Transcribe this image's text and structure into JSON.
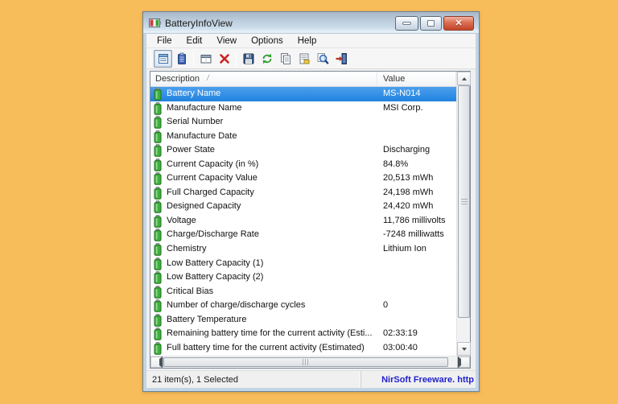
{
  "window": {
    "title": "BatteryInfoView",
    "controls": [
      "minimize-button",
      "maximize-button",
      "close-button"
    ]
  },
  "menu": {
    "items": [
      "File",
      "Edit",
      "View",
      "Options",
      "Help"
    ]
  },
  "toolbar": {
    "icons": [
      "details-view-icon",
      "report-view-icon",
      "choose-columns-icon",
      "delete-icon",
      "save-icon",
      "refresh-icon",
      "copy-icon",
      "properties-icon",
      "find-icon",
      "exit-icon"
    ],
    "active_icon": "details-view-icon"
  },
  "list": {
    "columns": {
      "description": "Description",
      "value": "Value"
    },
    "sort_indicator": "/",
    "rows": [
      {
        "description": "Battery Name",
        "value": "MS-N014",
        "selected": true
      },
      {
        "description": "Manufacture Name",
        "value": "MSI Corp.",
        "selected": false
      },
      {
        "description": "Serial Number",
        "value": "",
        "selected": false
      },
      {
        "description": "Manufacture Date",
        "value": "",
        "selected": false
      },
      {
        "description": "Power State",
        "value": "Discharging",
        "selected": false
      },
      {
        "description": "Current Capacity (in %)",
        "value": "84.8%",
        "selected": false
      },
      {
        "description": "Current Capacity Value",
        "value": "20,513 mWh",
        "selected": false
      },
      {
        "description": "Full Charged Capacity",
        "value": "24,198 mWh",
        "selected": false
      },
      {
        "description": "Designed Capacity",
        "value": "24,420 mWh",
        "selected": false
      },
      {
        "description": "Voltage",
        "value": "11,786 millivolts",
        "selected": false
      },
      {
        "description": "Charge/Discharge Rate",
        "value": "-7248 milliwatts",
        "selected": false
      },
      {
        "description": "Chemistry",
        "value": "Lithium Ion",
        "selected": false
      },
      {
        "description": "Low Battery Capacity (1)",
        "value": "",
        "selected": false
      },
      {
        "description": "Low Battery Capacity (2)",
        "value": "",
        "selected": false
      },
      {
        "description": "Critical Bias",
        "value": "",
        "selected": false
      },
      {
        "description": "Number of charge/discharge cycles",
        "value": "0",
        "selected": false
      },
      {
        "description": "Battery Temperature",
        "value": "",
        "selected": false
      },
      {
        "description": "Remaining battery time for the current activity (Esti...",
        "value": "02:33:19",
        "selected": false
      },
      {
        "description": "Full battery time for the current activity (Estimated)",
        "value": "03:00:40",
        "selected": false
      }
    ]
  },
  "status_bar": {
    "left": "21 item(s), 1 Selected",
    "right": "NirSoft Freeware.  http"
  },
  "colors": {
    "desktop_background": "#F8BD5B",
    "window_frame": "#C3D4E4",
    "selection_blue": "#2E8CE4",
    "battery_green": "#3FAE3F",
    "link_blue": "#2222CC",
    "close_red": "#DC7055"
  }
}
